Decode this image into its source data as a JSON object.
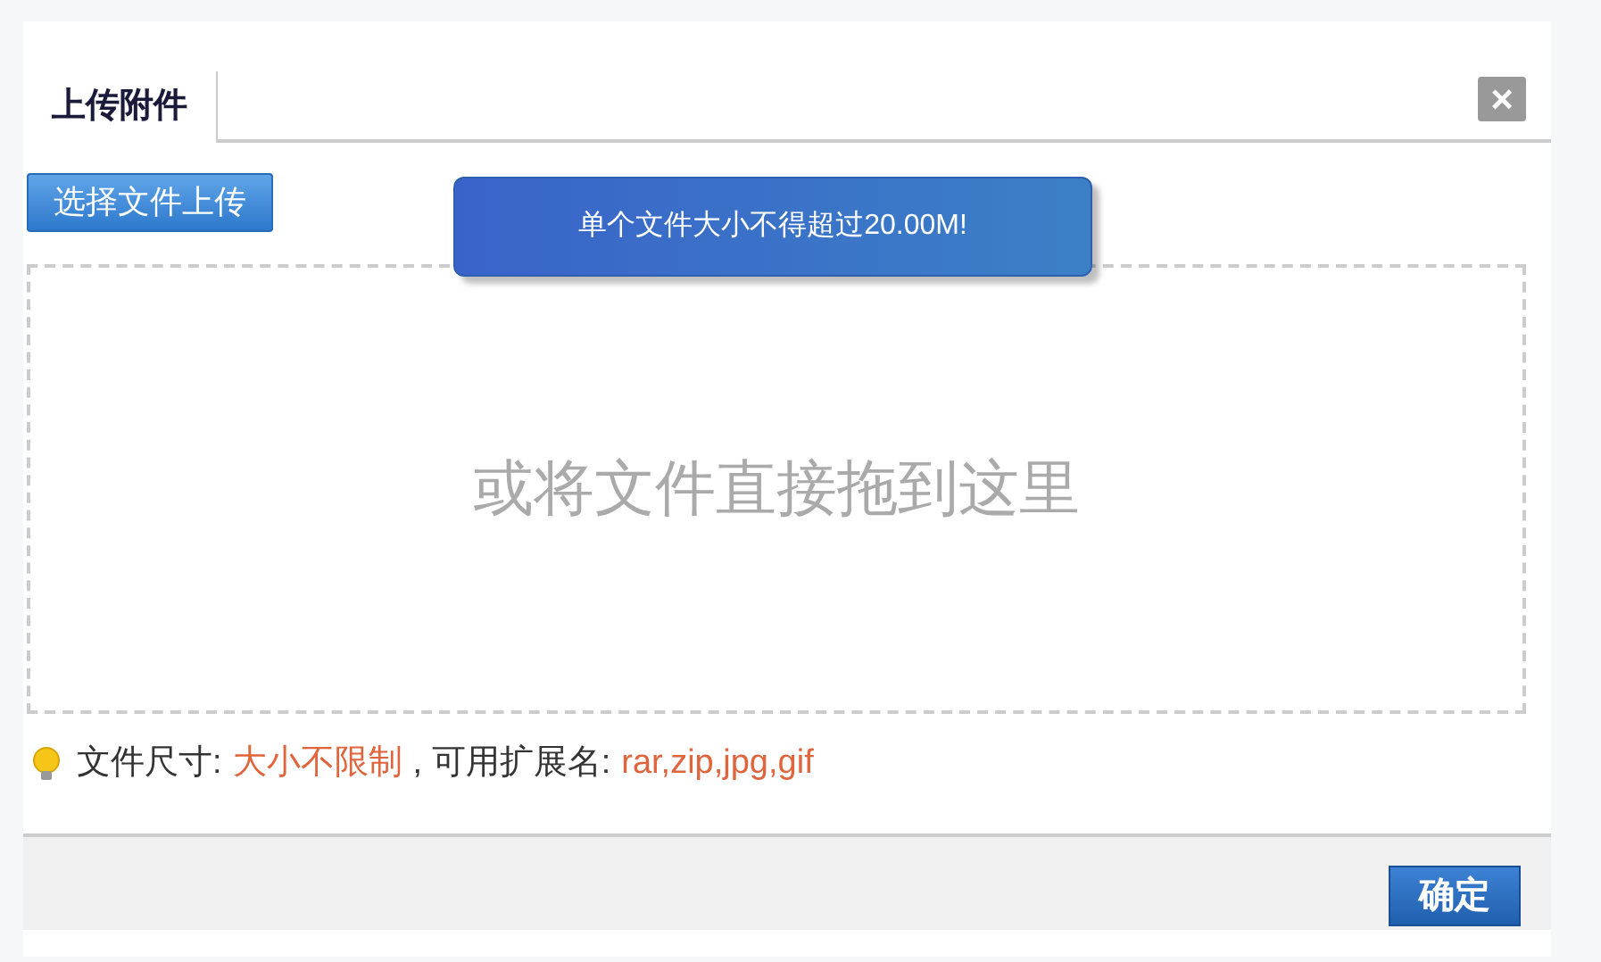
{
  "tabs": [
    {
      "label": "上传附件",
      "selected": true
    }
  ],
  "close_button": {
    "label": "×"
  },
  "select_button": {
    "label": "选择文件上传"
  },
  "toast": {
    "message": "单个文件大小不得超过20.00M!"
  },
  "dropzone": {
    "hint": "或将文件直接拖到这里"
  },
  "limits": [
    {
      "label": "文件尺寸:",
      "value": "大小不限制"
    },
    {
      "label": ", 可用扩展名:",
      "value": "rar,zip,jpg,gif"
    }
  ],
  "footer": {
    "ok_button": "确定"
  }
}
